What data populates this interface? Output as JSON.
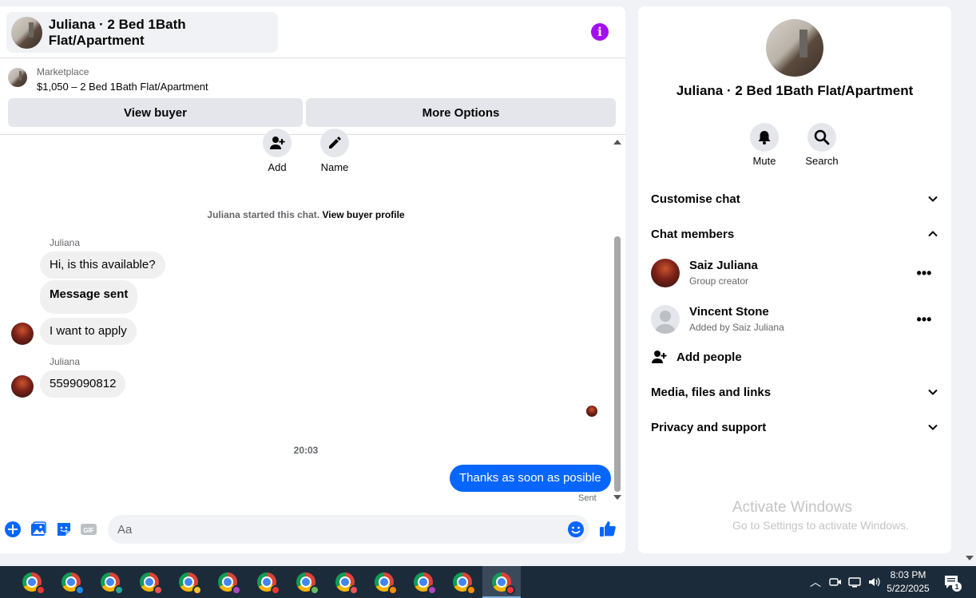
{
  "chat": {
    "header_title": "Juliana · 2 Bed 1Bath Flat/Apartment",
    "marketplace_label": "Marketplace",
    "listing": "$1,050 – 2 Bed 1Bath Flat/Apartment",
    "view_buyer_label": "View buyer",
    "more_options_label": "More Options",
    "actions": {
      "add_label": "Add",
      "name_label": "Name"
    },
    "started_text": "Juliana started this chat.",
    "view_buyer_profile": "View buyer profile",
    "messages": [
      {
        "sender": "Juliana",
        "text": "Hi, is this available?"
      },
      {
        "text": "Message sent"
      },
      {
        "text": "I want to apply"
      },
      {
        "sender": "Juliana",
        "text": "5599090812"
      }
    ],
    "timestamp": "20:03",
    "outgoing_text": "Thanks as soon as posible",
    "sent_label": "Sent",
    "composer_placeholder": "Aa"
  },
  "info_panel": {
    "title": "Juliana · 2 Bed 1Bath Flat/Apartment",
    "mute_label": "Mute",
    "search_label": "Search",
    "sections": {
      "customise": "Customise chat",
      "members": "Chat members",
      "media": "Media, files and links",
      "privacy": "Privacy and support"
    },
    "members": [
      {
        "name": "Saiz Juliana",
        "subtitle": "Group creator"
      },
      {
        "name": "Vincent Stone",
        "subtitle": "Added by Saiz Juliana"
      }
    ],
    "add_people": "Add people"
  },
  "watermark": {
    "line1": "Activate Windows",
    "line2": "Go to Settings to activate Windows."
  },
  "taskbar": {
    "time": "8:03 PM",
    "date": "5/22/2025",
    "notification_count": "1",
    "profile_badge_colors": [
      "#e53935",
      "#1e88e5",
      "#26a69a",
      "#ef5350",
      "#fbc02d",
      "#ab47bc",
      "#e53935",
      "#66bb6a",
      "#ef5350",
      "#fb8c00",
      "#ab47bc",
      "#fb8c00",
      "#e53935"
    ]
  },
  "colors": {
    "accent": "#0866ff",
    "info_icon": "#a30ff0"
  }
}
